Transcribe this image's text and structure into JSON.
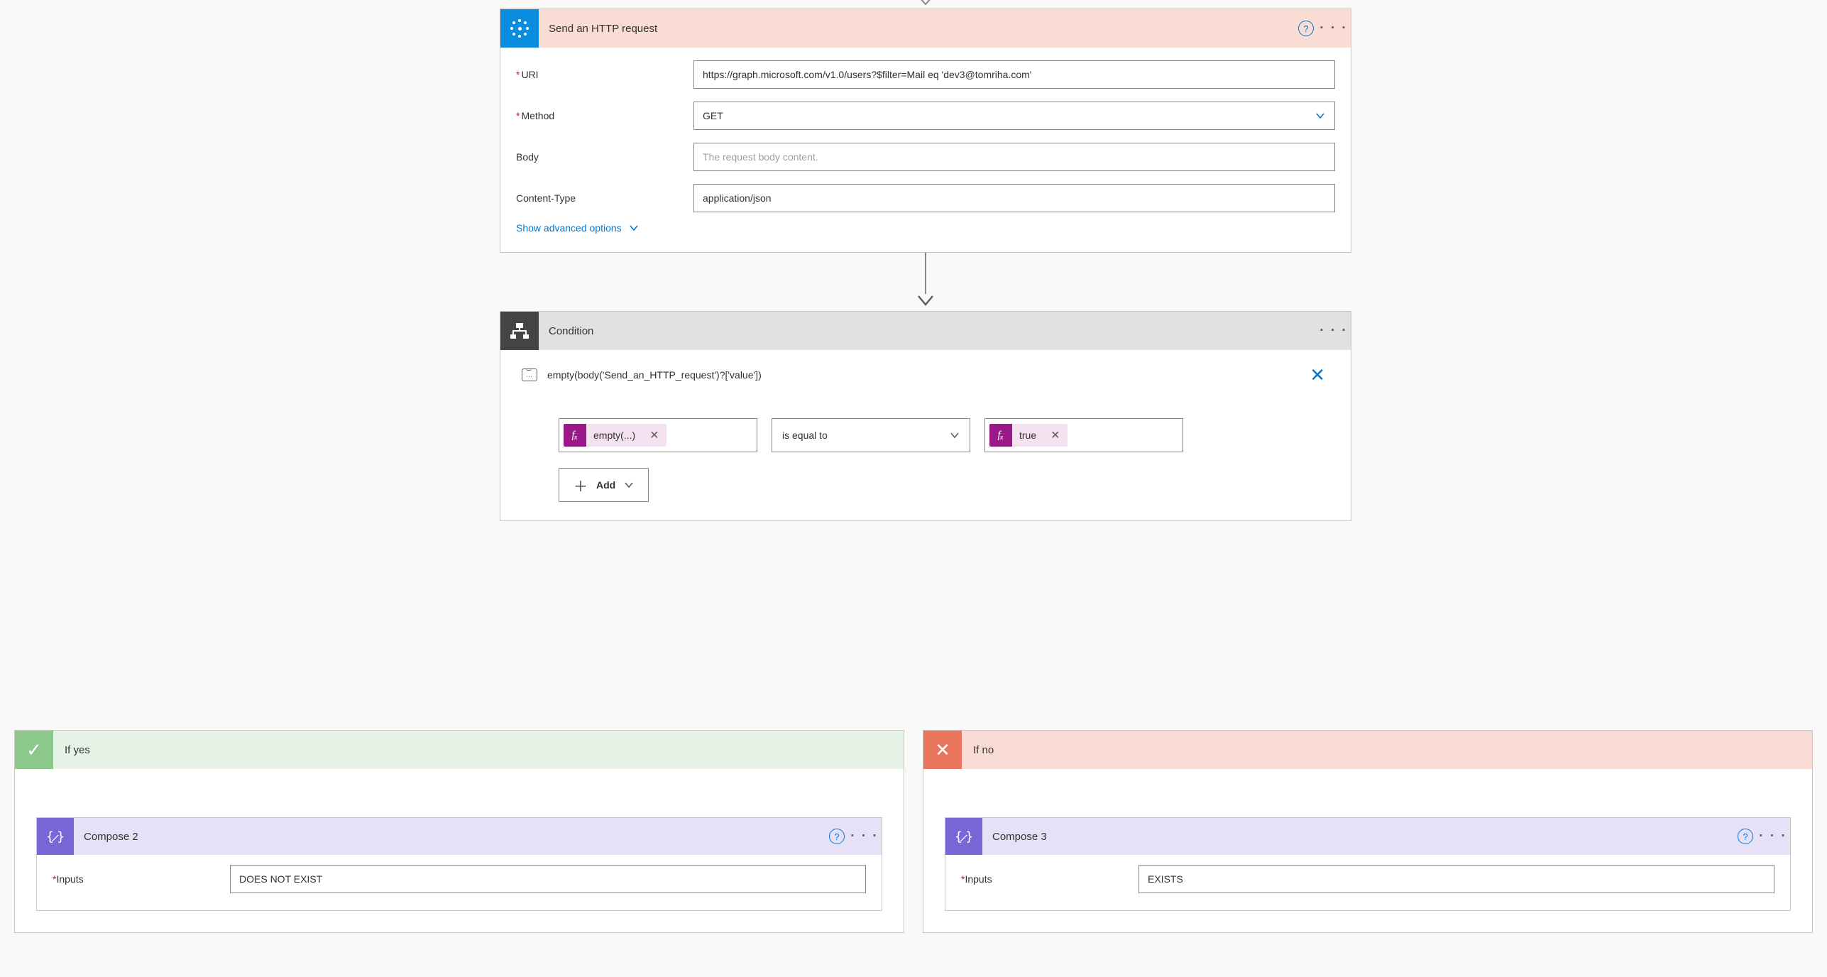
{
  "http": {
    "title": "Send an HTTP request",
    "fields": {
      "uri_label": "URI",
      "uri_value": "https://graph.microsoft.com/v1.0/users?$filter=Mail eq 'dev3@tomriha.com'",
      "method_label": "Method",
      "method_value": "GET",
      "body_label": "Body",
      "body_placeholder": "The request body content.",
      "ctype_label": "Content-Type",
      "ctype_value": "application/json"
    },
    "advanced": "Show advanced options"
  },
  "condition": {
    "title": "Condition",
    "expression": "empty(body('Send_an_HTTP_request')?['value'])",
    "left_token": "empty(...)",
    "operator": "is equal to",
    "right_token": "true",
    "add_label": "Add"
  },
  "branches": {
    "yes": {
      "title": "If yes",
      "compose_title": "Compose 2",
      "inputs_label": "Inputs",
      "inputs_value": "DOES NOT EXIST"
    },
    "no": {
      "title": "If no",
      "compose_title": "Compose 3",
      "inputs_label": "Inputs",
      "inputs_value": "EXISTS"
    }
  }
}
